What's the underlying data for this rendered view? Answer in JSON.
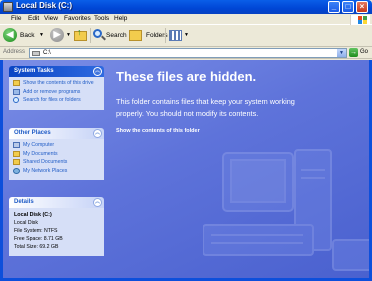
{
  "window": {
    "title": "Local Disk (C:)"
  },
  "menu": {
    "file": "File",
    "edit": "Edit",
    "view": "View",
    "favorites": "Favorites",
    "tools": "Tools",
    "help": "Help"
  },
  "toolbar": {
    "back": "Back",
    "search": "Search",
    "folders": "Folders"
  },
  "address": {
    "label": "Address",
    "value": "C:\\",
    "go": "Go"
  },
  "system_tasks": {
    "title": "System Tasks",
    "items": [
      {
        "label": "Show the contents of this drive",
        "icon": "show-contents-icon"
      },
      {
        "label": "Add or remove programs",
        "icon": "add-remove-icon"
      },
      {
        "label": "Search for files or folders",
        "icon": "search-icon"
      }
    ]
  },
  "other_places": {
    "title": "Other Places",
    "items": [
      {
        "label": "My Computer",
        "icon": "my-computer-icon"
      },
      {
        "label": "My Documents",
        "icon": "my-documents-icon"
      },
      {
        "label": "Shared Documents",
        "icon": "shared-documents-icon"
      },
      {
        "label": "My Network Places",
        "icon": "network-places-icon"
      }
    ]
  },
  "details": {
    "title": "Details",
    "name": "Local Disk (C:)",
    "type": "Local Disk",
    "file_system": "File System: NTFS",
    "free_space": "Free Space: 8.71 GB",
    "total_size": "Total Size: 69.2 GB"
  },
  "content": {
    "warning_title": "These files are hidden.",
    "warning_message": "This folder contains files that keep your system working properly. You should not modify its contents.",
    "show_link": "Show the contents of this folder"
  },
  "colors": {
    "titlebar": "#0046d5",
    "content_bg": "#5e73da",
    "panel_body": "#d6dff7",
    "link": "#215dc6"
  }
}
